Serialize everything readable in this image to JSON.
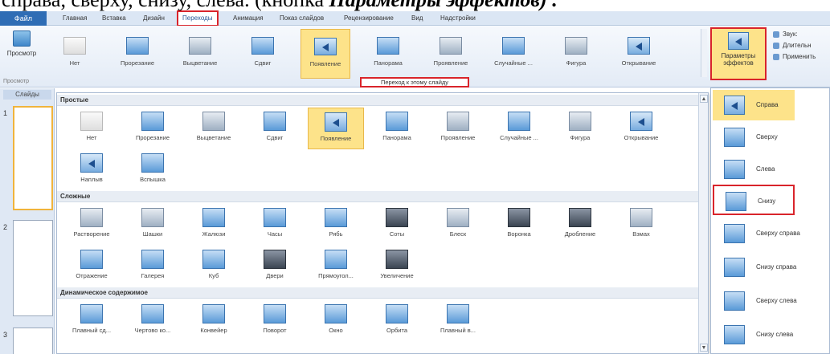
{
  "caption": {
    "text_plain": "справа, сверху, снизу, слева. (кнопка ",
    "text_bold": "Параметры эффектов) ."
  },
  "tabs": {
    "file": "Файл",
    "items": [
      "Главная",
      "Вставка",
      "Дизайн",
      "Переходы",
      "Анимация",
      "Показ слайдов",
      "Рецензирование",
      "Вид",
      "Надстройки"
    ],
    "active": "Переходы"
  },
  "ribbon": {
    "preview_label": "Просмотр",
    "preview_group_label": "Просмотр",
    "gallery": [
      "Нет",
      "Прорезание",
      "Выцветание",
      "Сдвиг",
      "Появление",
      "Панорама",
      "Проявление",
      "Случайные ...",
      "Фигура",
      "Открывание"
    ],
    "selected": "Появление",
    "params_label": "Параметры эффектов",
    "side_options": [
      "Звук:",
      "Длительн",
      "Применить"
    ],
    "tooltip": "Переход к этому слайду"
  },
  "slides_panel": {
    "tab_label": "Слайды",
    "numbers": [
      "1",
      "2",
      "3"
    ]
  },
  "dropdown": {
    "sections": [
      {
        "title": "Простые",
        "items": [
          "Нет",
          "Прорезание",
          "Выцветание",
          "Сдвиг",
          "Появление",
          "Панорама",
          "Проявление",
          "Случайные ...",
          "Фигура",
          "Открывание",
          "Наплыв",
          "Вспышка"
        ]
      },
      {
        "title": "Сложные",
        "items": [
          "Растворение",
          "Шашки",
          "Жалюзи",
          "Часы",
          "Рябь",
          "Соты",
          "Блеск",
          "Воронка",
          "Дробление",
          "Взмах",
          "Отражение",
          "Галерея",
          "Куб",
          "Двери",
          "Прямоугол...",
          "Увеличение"
        ]
      },
      {
        "title": "Динамическое содержимое",
        "items": [
          "Плавный сд...",
          "Чертово ко...",
          "Конвейер",
          "Поворот",
          "Окно",
          "Орбита",
          "Плавный в..."
        ]
      }
    ],
    "selected": "Появление"
  },
  "effects": {
    "items": [
      "Справа",
      "Сверху",
      "Слева",
      "Снизу",
      "Сверху справа",
      "Снизу справа",
      "Сверху слева",
      "Снизу слева"
    ],
    "highlighted": "Снизу",
    "selected": "Справа"
  }
}
